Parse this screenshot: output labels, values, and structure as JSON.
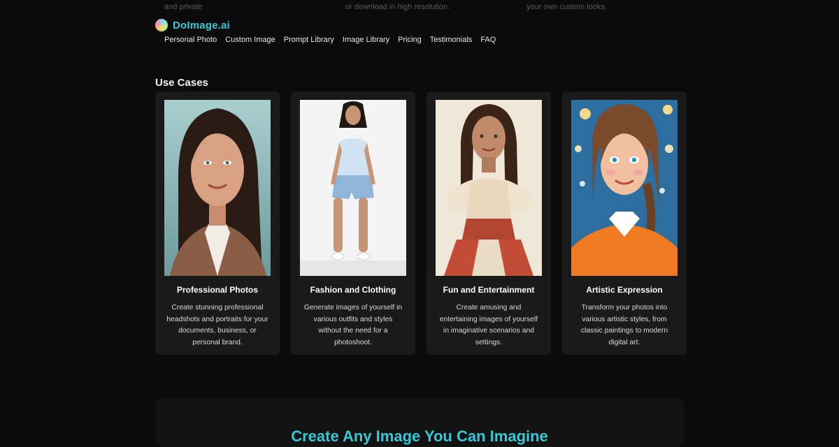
{
  "top_fragments": [
    "and private",
    "or download in high resolution.",
    "your own custom looks."
  ],
  "brand": {
    "name": "DoImage.ai",
    "accent": "#35c8d6"
  },
  "nav": [
    "Personal Photo",
    "Custom Image",
    "Prompt Library",
    "Image Library",
    "Pricing",
    "Testimonials",
    "FAQ"
  ],
  "section_title": "Use Cases",
  "cards": [
    {
      "title": "Professional Photos",
      "description": "Create stunning professional headshots and portraits for your documents, business, or personal brand."
    },
    {
      "title": "Fashion and Clothing",
      "description": "Generate images of yourself in various outfits and styles without the need for a photoshoot."
    },
    {
      "title": "Fun and Entertainment",
      "description": "Create amusing and entertaining images of yourself in imaginative scenarios and settings."
    },
    {
      "title": "Artistic Expression",
      "description": "Transform your photos into various artistic styles, from classic paintings to modern digital art."
    }
  ],
  "bottom_heading": "Create Any Image You Can Imagine"
}
